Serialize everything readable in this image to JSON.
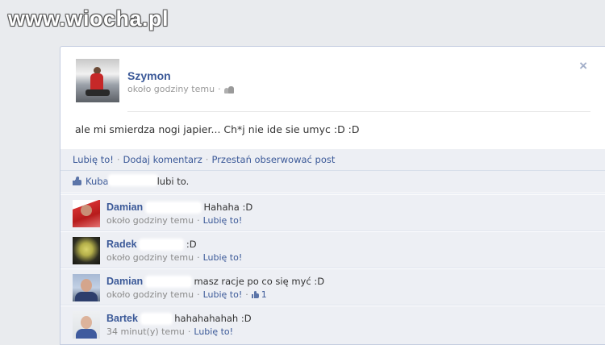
{
  "watermark": {
    "text": "www.wiocha.pl"
  },
  "post": {
    "author": "Szymon",
    "time": "około godziny temu",
    "time_sep": "·",
    "close_label": "×",
    "body": "ale mi smierdza nogi japier... Ch*j nie ide sie umyc :D :D",
    "privacy_icon": "friends-icon"
  },
  "actions": {
    "like": "Lubię to!",
    "comment": "Dodaj komentarz",
    "unfollow": "Przestań obserwować post",
    "sep": "·"
  },
  "likes": {
    "name": "Kuba",
    "suffix": "lubi to."
  },
  "comments": [
    {
      "name": "Damian",
      "text": "Hahaha :D",
      "time": "około godziny temu",
      "like_label": "Lubię to!",
      "likes_count": ""
    },
    {
      "name": "Radek",
      "text": ":D",
      "time": "około godziny temu",
      "like_label": "Lubię to!",
      "likes_count": ""
    },
    {
      "name": "Damian",
      "text": "masz racje po co się myć :D",
      "time": "około godziny temu",
      "like_label": "Lubię to!",
      "likes_count": "1"
    },
    {
      "name": "Bartek",
      "text": "hahahahahah :D",
      "time": "34 minut(y) temu",
      "like_label": "Lubię to!",
      "likes_count": ""
    }
  ],
  "colors": {
    "link": "#3b5998",
    "meta": "#999999",
    "feedback_bg": "#edeff4",
    "page_bg": "#e9ebee"
  }
}
